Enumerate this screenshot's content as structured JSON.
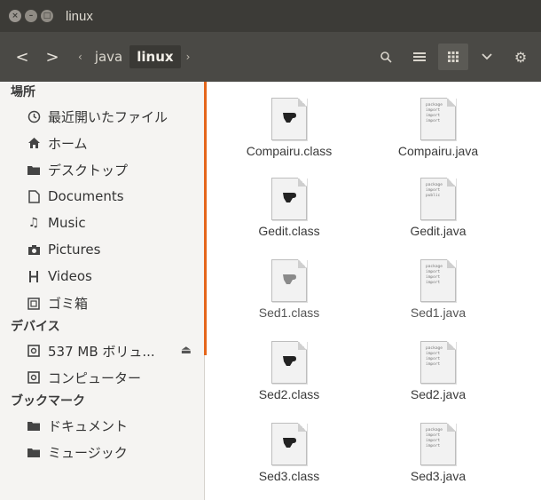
{
  "window": {
    "title": "linux"
  },
  "toolbar": {
    "back_icon": "back-icon",
    "forward_icon": "forward-icon",
    "breadcrumbs": [
      "java",
      "linux"
    ],
    "right_buttons": [
      "search-icon",
      "list-view-icon",
      "grid-view-icon",
      "view-options-icon",
      "gear-icon"
    ]
  },
  "sidebar": {
    "sections": [
      {
        "title": "場所",
        "items": [
          {
            "label": "最近開いたファイル",
            "icon": "clock-icon"
          },
          {
            "label": "ホーム",
            "icon": "home-icon"
          },
          {
            "label": "デスクトップ",
            "icon": "folder-icon"
          },
          {
            "label": "Documents",
            "icon": "document-icon"
          },
          {
            "label": "Music",
            "icon": "music-icon"
          },
          {
            "label": "Pictures",
            "icon": "camera-icon"
          },
          {
            "label": "Videos",
            "icon": "film-icon"
          },
          {
            "label": "ゴミ箱",
            "icon": "trash-icon"
          }
        ]
      },
      {
        "title": "デバイス",
        "items": [
          {
            "label": "537 MB ボリュ...",
            "icon": "drive-icon",
            "eject": true
          },
          {
            "label": "コンピューター",
            "icon": "drive-icon"
          }
        ]
      },
      {
        "title": "ブックマーク",
        "items": [
          {
            "label": "ドキュメント",
            "icon": "folder-icon"
          },
          {
            "label": "ミュージック",
            "icon": "folder-icon"
          }
        ]
      }
    ]
  },
  "files": [
    {
      "name": "Compairu.class",
      "kind": "class"
    },
    {
      "name": "Compairu.java",
      "kind": "java",
      "snippet": [
        "package",
        "import",
        "import",
        "import"
      ]
    },
    {
      "name": "Gedit.class",
      "kind": "class"
    },
    {
      "name": "Gedit.java",
      "kind": "java",
      "snippet": [
        "package",
        "import",
        "",
        "public"
      ]
    },
    {
      "name": "Sed1.class",
      "kind": "class"
    },
    {
      "name": "Sed1.java",
      "kind": "java",
      "snippet": [
        "package",
        "import",
        "import",
        "import"
      ]
    },
    {
      "name": "Sed2.class",
      "kind": "class"
    },
    {
      "name": "Sed2.java",
      "kind": "java",
      "snippet": [
        "package",
        "import",
        "import",
        "import"
      ]
    },
    {
      "name": "Sed3.class",
      "kind": "class"
    },
    {
      "name": "Sed3.java",
      "kind": "java",
      "snippet": [
        "package",
        "import",
        "import",
        "import"
      ]
    }
  ]
}
